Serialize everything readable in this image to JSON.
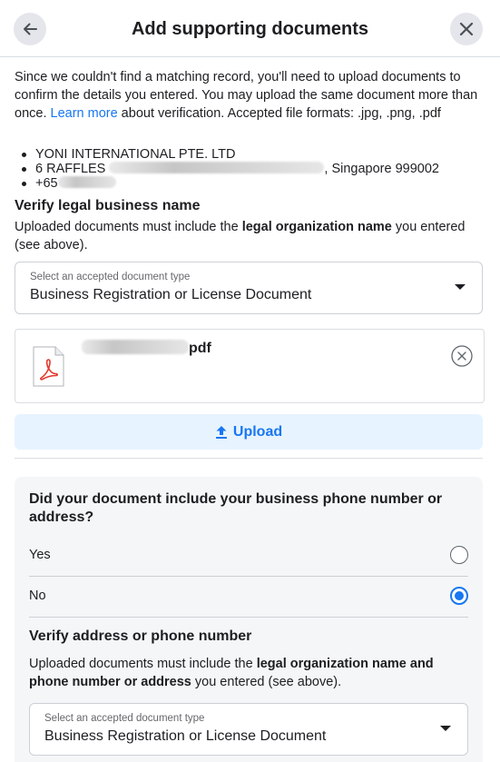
{
  "header": {
    "title": "Add supporting documents",
    "back_icon": "arrow-left-icon",
    "close_icon": "close-x-icon"
  },
  "intro": {
    "text_before_link": "Since we couldn't find a matching record, you'll need to upload documents to confirm the details you entered. You may upload the same document more than once. ",
    "link": "Learn more",
    "text_after_link": " about verification. Accepted file formats: .jpg, .png, .pdf"
  },
  "business": {
    "name": "YONI INTERNATIONAL PTE. LTD",
    "address_prefix": "6 RAFFLES",
    "address_suffix": ", Singapore 999002",
    "phone_prefix": "+65"
  },
  "legal_name_section": {
    "title": "Verify legal business name",
    "desc_before": "Uploaded documents must include the ",
    "desc_bold": "legal organization name",
    "desc_after": " you entered (see above).",
    "select_label": "Select an accepted document type",
    "select_value": "Business Registration or License Document"
  },
  "uploaded_file": {
    "name_suffix": "pdf",
    "icon": "pdf-file-icon",
    "remove_icon": "remove-circle-x-icon"
  },
  "upload_button": {
    "label": "Upload",
    "icon": "upload-arrow-icon"
  },
  "question": {
    "title": "Did your document include your business phone number or address?",
    "options": [
      {
        "label": "Yes",
        "selected": false
      },
      {
        "label": "No",
        "selected": true
      }
    ]
  },
  "address_section": {
    "title": "Verify address or phone number",
    "desc_before": "Uploaded documents must include the ",
    "desc_bold": "legal organization name and phone number or address",
    "desc_after": " you entered (see above).",
    "select_label": "Select an accepted document type",
    "select_value": "Business Registration or License Document"
  },
  "colors": {
    "accent": "#1877f2",
    "upload_bg": "#e7f3ff",
    "panel_bg": "#f5f6f7",
    "pdf_red": "#e0382f"
  }
}
